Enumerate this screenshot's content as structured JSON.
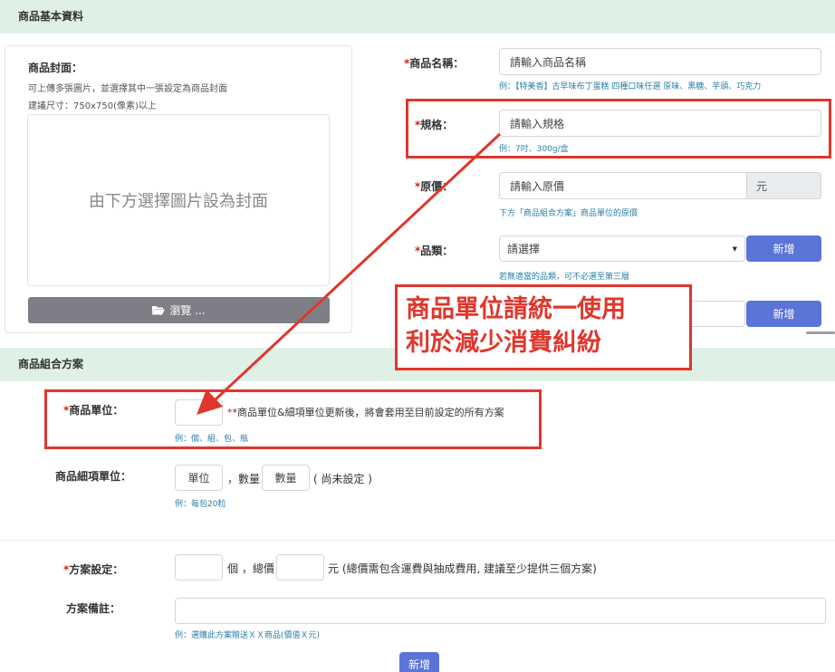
{
  "basic_section": {
    "title": "商品基本資料"
  },
  "cover": {
    "label": "商品封面：",
    "hint1": "可上傳多張圖片，並選擇其中一張設定為商品封面",
    "hint2": "建議尺寸：750x750(像素)以上",
    "drop_text": "由下方選擇圖片設為封面",
    "browse_label": "瀏覽 ..."
  },
  "product_name": {
    "label": "商品名稱：",
    "placeholder": "請輸入商品名稱",
    "hint": "例：【特美香】古早味布丁蛋糕 四種口味任選 原味、黑糖、芋頭、巧克力"
  },
  "spec": {
    "label": "規格：",
    "placeholder": "請輸入規格",
    "hint": "例：7吋、300g/盒"
  },
  "price": {
    "label": "原價：",
    "placeholder": "請輸入原價",
    "unit": "元",
    "hint": "下方「商品組合方案」商品單位的原價"
  },
  "category": {
    "label": "品類：",
    "selected": "請選擇",
    "add_label": "新增",
    "hint": "若無適當的品類，可不必選至第三層"
  },
  "second_add": {
    "label": "新增"
  },
  "callout": {
    "line1": "商品單位請統一使用",
    "line2": "利於減少消費糾紛"
  },
  "combo_section": {
    "title": "商品組合方案"
  },
  "unit": {
    "label": "商品單位：",
    "note": "*商品單位&細項單位更新後，將會套用至目前設定的所有方案",
    "hint": "例：個、組、包、瓶"
  },
  "detail_unit": {
    "label": "商品細項單位：",
    "unit_placeholder": "單位",
    "qty_sep": "，數量",
    "qty_placeholder": "數量",
    "status": "( 尚未設定 )",
    "hint": "例：每包20粒"
  },
  "plan": {
    "label": "方案設定：",
    "unit_suffix": "個 ，總價",
    "price_suffix": "元 (總價需包含運費與抽成費用, 建議至少提供三個方案)"
  },
  "plan_note": {
    "label": "方案備註：",
    "hint": "例：選購此方案贈送ＸＸ商品(價值Ｘ元)"
  },
  "add_plan": {
    "label": "新增"
  },
  "colors": {
    "accent": "#5a74d8",
    "section_bg": "#dff1e6",
    "annotation_red": "#e0362b",
    "hint_blue": "#2a7fa8"
  }
}
